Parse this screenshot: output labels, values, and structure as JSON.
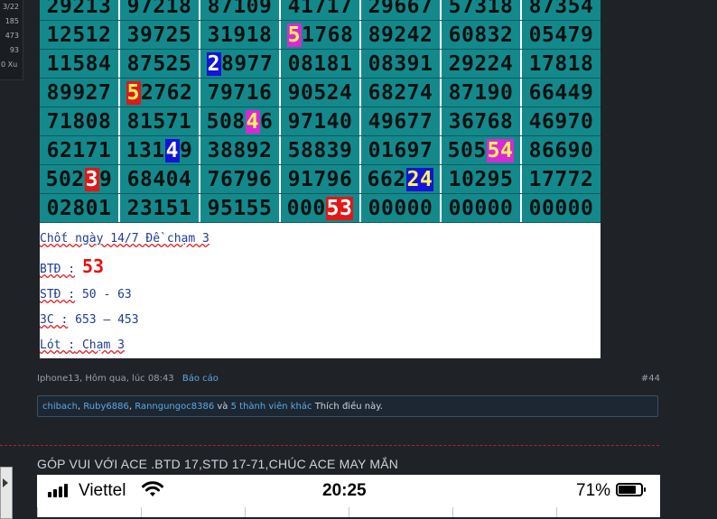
{
  "sidebar_stub": {
    "lines": [
      "3/22",
      "185",
      "473",
      "93",
      "0 Xu"
    ]
  },
  "board": {
    "rows": [
      [
        [
          {
            "t": "29213"
          }
        ],
        [
          {
            "t": "97218"
          }
        ],
        [
          {
            "t": "87109"
          }
        ],
        [
          {
            "t": "41717"
          }
        ],
        [
          {
            "t": "29667"
          }
        ],
        [
          {
            "t": "57318"
          }
        ],
        [
          {
            "t": "87354"
          }
        ]
      ],
      [
        [
          {
            "t": "12512"
          }
        ],
        [
          {
            "t": "39725"
          }
        ],
        [
          {
            "t": "31918"
          }
        ],
        [
          {
            "t": "5",
            "h": "hl-magenta"
          },
          {
            "t": "1768"
          }
        ],
        [
          {
            "t": "89242"
          }
        ],
        [
          {
            "t": "60832"
          }
        ],
        [
          {
            "t": "05479"
          }
        ]
      ],
      [
        [
          {
            "t": "11584"
          }
        ],
        [
          {
            "t": "87525"
          }
        ],
        [
          {
            "t": "2",
            "h": "hl-blue"
          },
          {
            "t": "8977"
          }
        ],
        [
          {
            "t": "08181"
          }
        ],
        [
          {
            "t": "08391"
          }
        ],
        [
          {
            "t": "29224"
          }
        ],
        [
          {
            "t": "17818"
          }
        ]
      ],
      [
        [
          {
            "t": "89927"
          }
        ],
        [
          {
            "t": "5",
            "h": "hl-red-y"
          },
          {
            "t": "2762"
          }
        ],
        [
          {
            "t": "79716"
          }
        ],
        [
          {
            "t": "90524"
          }
        ],
        [
          {
            "t": "68274"
          }
        ],
        [
          {
            "t": "87190"
          }
        ],
        [
          {
            "t": "66449"
          }
        ]
      ],
      [
        [
          {
            "t": "71808"
          }
        ],
        [
          {
            "t": "81571"
          }
        ],
        [
          {
            "t": "508"
          },
          {
            "t": "4",
            "h": "hl-magenta"
          },
          {
            "t": "6"
          }
        ],
        [
          {
            "t": "97140"
          }
        ],
        [
          {
            "t": "49677"
          }
        ],
        [
          {
            "t": "36768"
          }
        ],
        [
          {
            "t": "46970"
          }
        ]
      ],
      [
        [
          {
            "t": "62171"
          }
        ],
        [
          {
            "t": "131"
          },
          {
            "t": "4",
            "h": "hl-blue"
          },
          {
            "t": "9"
          }
        ],
        [
          {
            "t": "38892"
          }
        ],
        [
          {
            "t": "58839"
          }
        ],
        [
          {
            "t": "01697"
          }
        ],
        [
          {
            "t": "505"
          },
          {
            "t": "54",
            "h": "hl-magenta"
          }
        ],
        [
          {
            "t": "86690"
          }
        ]
      ],
      [
        [
          {
            "t": "502"
          },
          {
            "t": "3",
            "h": "hl-red"
          },
          {
            "t": "9"
          }
        ],
        [
          {
            "t": "68404"
          }
        ],
        [
          {
            "t": "76796"
          }
        ],
        [
          {
            "t": "91796"
          }
        ],
        [
          {
            "t": "662"
          },
          {
            "t": "24",
            "h": "hl-blue-y"
          }
        ],
        [
          {
            "t": "10295"
          }
        ],
        [
          {
            "t": "17772"
          }
        ]
      ],
      [
        [
          {
            "t": "02801"
          }
        ],
        [
          {
            "t": "23151"
          }
        ],
        [
          {
            "t": "95155"
          }
        ],
        [
          {
            "t": "000"
          },
          {
            "t": "53",
            "h": "hl-red"
          }
        ],
        [
          {
            "t": "00000"
          }
        ],
        [
          {
            "t": "00000"
          }
        ],
        [
          {
            "t": "00000"
          }
        ]
      ]
    ]
  },
  "notes": {
    "line1": "Chốt ngày 14/7 Đề chạm 3",
    "btd_label": "BTĐ :",
    "btd_value": "53",
    "std_label": "STĐ :",
    "std_value": " 50 - 63",
    "c3_label": "3C :",
    "c3_value": " 653  – 453",
    "lot_label": "Lót :",
    "lot_value": " Chạm 3"
  },
  "post_meta": {
    "author_time": "Iphone13, Hôm qua, lúc 08:43",
    "report": "Báo cáo",
    "post_number": "#44"
  },
  "likes": {
    "users": [
      "chibach",
      "Ruby6886",
      "Ranngungoc8386"
    ],
    "joiner": "và",
    "others": "5 thành viên khác",
    "suffix": "Thích điều này."
  },
  "next_post": {
    "title": "GÓP VUI VỚI ACE .BTD 17,STD 17-71,CHÚC ACE MAY MẮN"
  },
  "phone": {
    "carrier": "Viettel",
    "time": "20:25",
    "battery_pct": "71%",
    "battery_level": 0.71
  }
}
